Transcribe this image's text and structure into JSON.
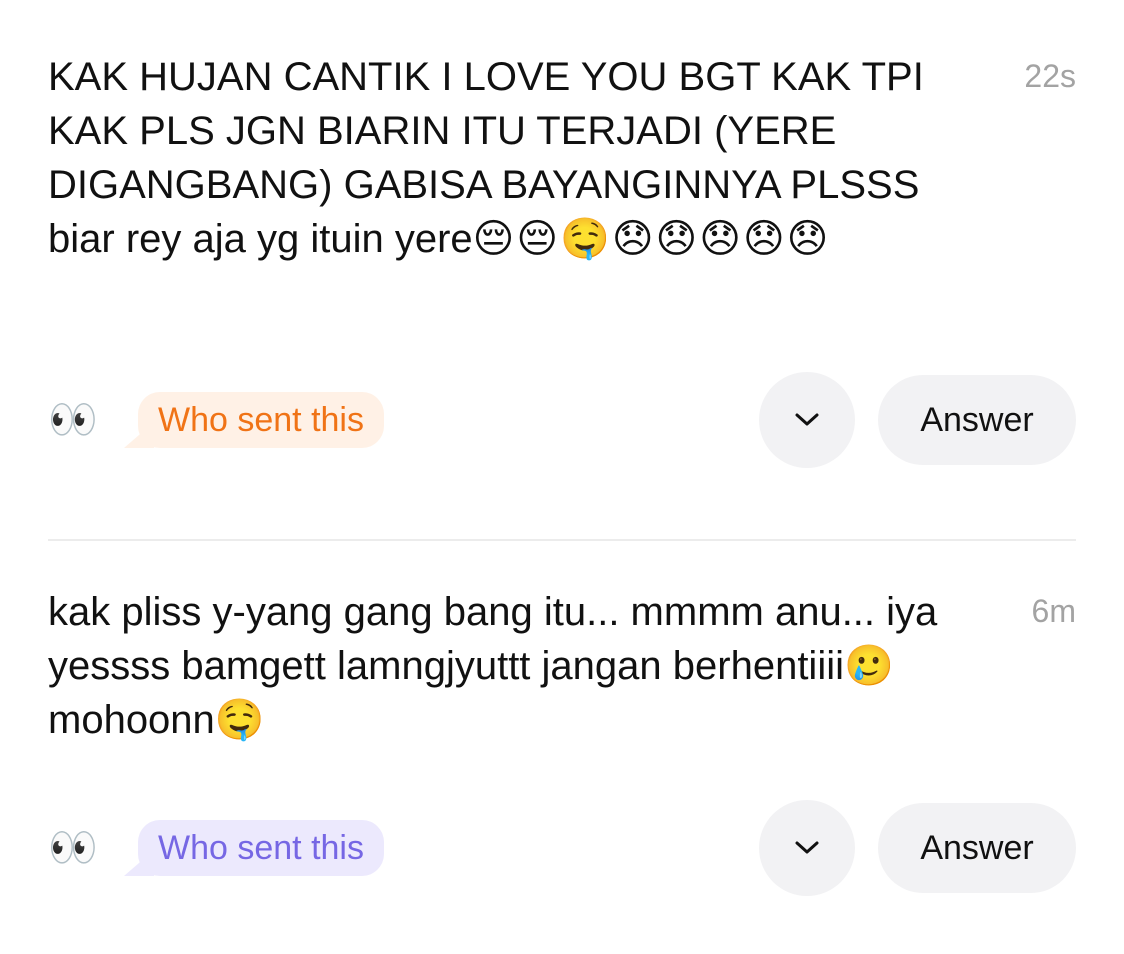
{
  "questions": [
    {
      "text": "KAK HUJAN CANTIK I LOVE YOU BGT KAK TPI KAK PLS JGN BIARIN ITU TERJADI (YERE DIGANGBANG) GABISA BAYANGINNYA PLSSS biar rey aja yg ituin yere",
      "emojis": "😔😔🤤😞😞😞😞😞",
      "timestamp": "22s",
      "eyes_icon": "👀",
      "who_sent_label": "Who sent this",
      "who_sent_color": "#f07316",
      "answer_label": "Answer"
    },
    {
      "text": "kak pliss y-yang gang bang itu... mmmm anu... iya yessss bamgett lamngjyuttt jangan berhentiiii",
      "emoji_mid": "🥲",
      "text_tail": " mohoonn",
      "emoji_end": "🤤",
      "timestamp": "6m",
      "eyes_icon": "👀",
      "who_sent_label": "Who sent this",
      "who_sent_color": "#7667e4",
      "answer_label": "Answer"
    }
  ]
}
